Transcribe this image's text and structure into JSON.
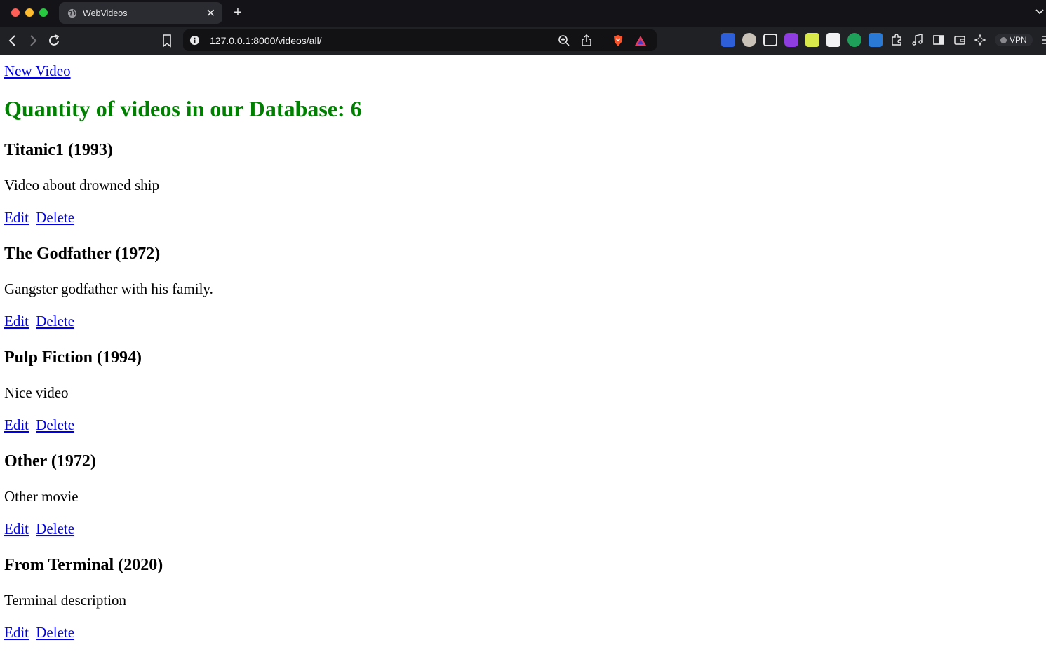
{
  "browser": {
    "tab": {
      "title": "WebVideos"
    },
    "url": "127.0.0.1:8000/videos/all/",
    "vpn_label": "VPN"
  },
  "page": {
    "new_video_label": "New Video",
    "count_heading": "Quantity of videos in our Database: 6",
    "edit_label": "Edit",
    "delete_label": "Delete",
    "videos": [
      {
        "title": "Titanic1 (1993)",
        "description": "Video about drowned ship"
      },
      {
        "title": "The Godfather (1972)",
        "description": "Gangster godfather with his family."
      },
      {
        "title": "Pulp Fiction (1994)",
        "description": "Nice video"
      },
      {
        "title": "Other (1972)",
        "description": "Other movie"
      },
      {
        "title": "From Terminal (2020)",
        "description": "Terminal description"
      }
    ]
  },
  "colors": {
    "heading_green": "#008000",
    "link_blue": "#0000ee",
    "chrome_dark": "#202124"
  }
}
